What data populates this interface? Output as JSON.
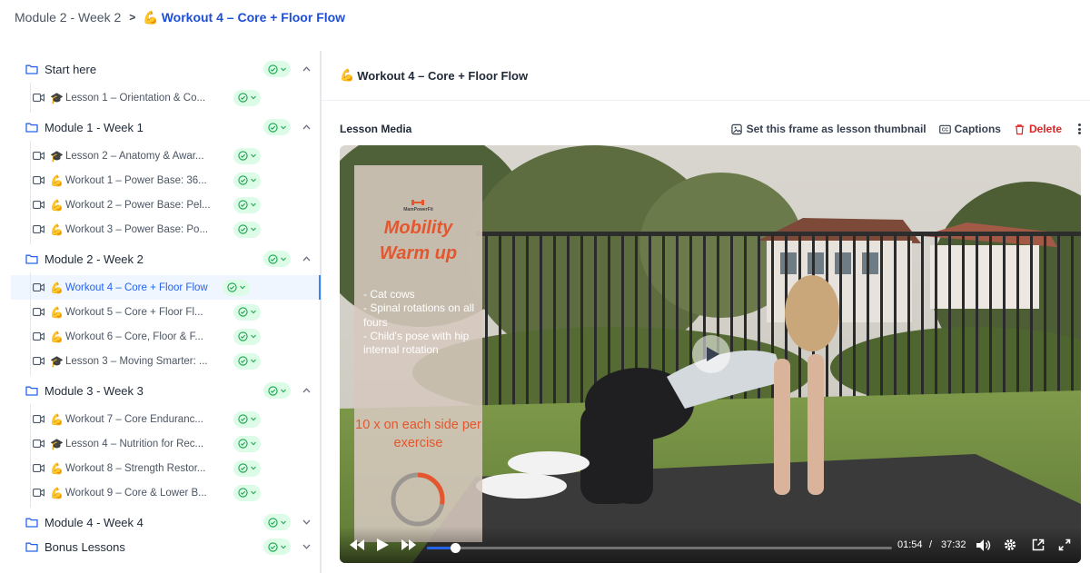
{
  "breadcrumb": {
    "parent": "Module 2 - Week 2",
    "separator": ">",
    "current_emoji": "💪",
    "current": "Workout 4 – Core + Floor Flow"
  },
  "sidebar": {
    "modules": [
      {
        "title": "Start here",
        "expanded": true,
        "lessons": [
          {
            "emoji": "🎓",
            "label": "Lesson 1 – Orientation & Co..."
          }
        ]
      },
      {
        "title": "Module 1 - Week 1",
        "expanded": true,
        "lessons": [
          {
            "emoji": "🎓",
            "label": "Lesson 2 – Anatomy & Awar..."
          },
          {
            "emoji": "💪",
            "label": "Workout 1 – Power Base: 36..."
          },
          {
            "emoji": "💪",
            "label": "Workout 2 – Power Base: Pel..."
          },
          {
            "emoji": "💪",
            "label": "Workout 3 – Power Base: Po..."
          }
        ]
      },
      {
        "title": "Module 2 - Week 2",
        "expanded": true,
        "lessons": [
          {
            "emoji": "💪",
            "label": "Workout 4 – Core + Floor Flow",
            "active": true
          },
          {
            "emoji": "💪",
            "label": "Workout 5 – Core + Floor Fl..."
          },
          {
            "emoji": "💪",
            "label": "Workout 6 – Core, Floor & F..."
          },
          {
            "emoji": "🎓",
            "label": "Lesson 3 – Moving Smarter: ..."
          }
        ]
      },
      {
        "title": "Module 3 - Week 3",
        "expanded": true,
        "lessons": [
          {
            "emoji": "💪",
            "label": "Workout 7 – Core Enduranc..."
          },
          {
            "emoji": "🎓",
            "label": "Lesson 4 – Nutrition for Rec..."
          },
          {
            "emoji": "💪",
            "label": "Workout 8 – Strength Restor..."
          },
          {
            "emoji": "💪",
            "label": "Workout 9 – Core & Lower B..."
          }
        ]
      },
      {
        "title": "Module 4 - Week 4",
        "expanded": false,
        "lessons": []
      },
      {
        "title": "Bonus Lessons",
        "expanded": false,
        "lessons": []
      }
    ]
  },
  "main": {
    "header_emoji": "💪",
    "header_title": "Workout 4 – Core + Floor Flow",
    "media_title": "Lesson Media",
    "actions": {
      "thumbnail": "Set this frame as lesson thumbnail",
      "captions": "Captions",
      "delete": "Delete"
    }
  },
  "video": {
    "overlay": {
      "brand": "MamPowerFit",
      "title_line1": "Mobility",
      "title_line2": "Warm up",
      "list": [
        "- Cat cows",
        "- Spinal rotations on all fours",
        "- Child's pose with hip internal rotation"
      ],
      "count": "10 x on each side per exercise",
      "timer_fraction": 0.28
    },
    "current_time": "01:54",
    "time_separator": "/",
    "duration": "37:32",
    "progress_fraction": 0.06
  },
  "colors": {
    "accent": "#2563eb",
    "status_bg": "#dcfce7",
    "status_check": "#16a34a",
    "delete": "#dc2626",
    "overlay_text": "#e4572e"
  }
}
